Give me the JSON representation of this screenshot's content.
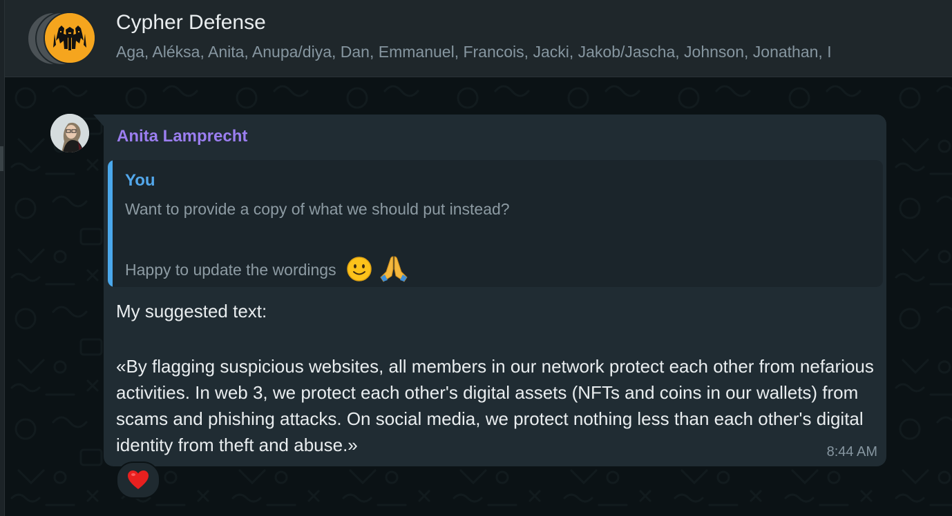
{
  "header": {
    "title": "Cypher Defense",
    "members": "Aga, Aléksa, Anita, Anupa/diya, Dan, Emmanuel, Francois, Jacki, Jakob/Jascha, Johnson, Jonathan, I",
    "group_avatar_icon": "group-logo-icon",
    "group_avatar_color": "#f5a51e"
  },
  "message": {
    "sender": "Anita Lamprecht",
    "sender_color": "#9b7ef0",
    "quote": {
      "author": "You",
      "line1": "Want to provide a copy of what we should put instead?",
      "line2": "Happy to update the wordings",
      "emojis": [
        "slightly-smiling-face-icon",
        "folded-hands-icon"
      ]
    },
    "intro": "My suggested text:",
    "body": "«By flagging suspicious websites, all members in our network protect each other from nefarious activities. In web 3, we protect each other's digital assets (NFTs and coins in our wallets) from scams and phishing attacks. On social media, we protect nothing less than each other's digital identity from theft and abuse.»",
    "time": "8:44 AM",
    "reaction": "heart-icon"
  },
  "colors": {
    "header_bg": "#1f272b",
    "bubble_bg": "#202c33",
    "quote_bar": "#4aa8ec",
    "text_primary": "#e9edef",
    "text_secondary": "#8696a0"
  }
}
